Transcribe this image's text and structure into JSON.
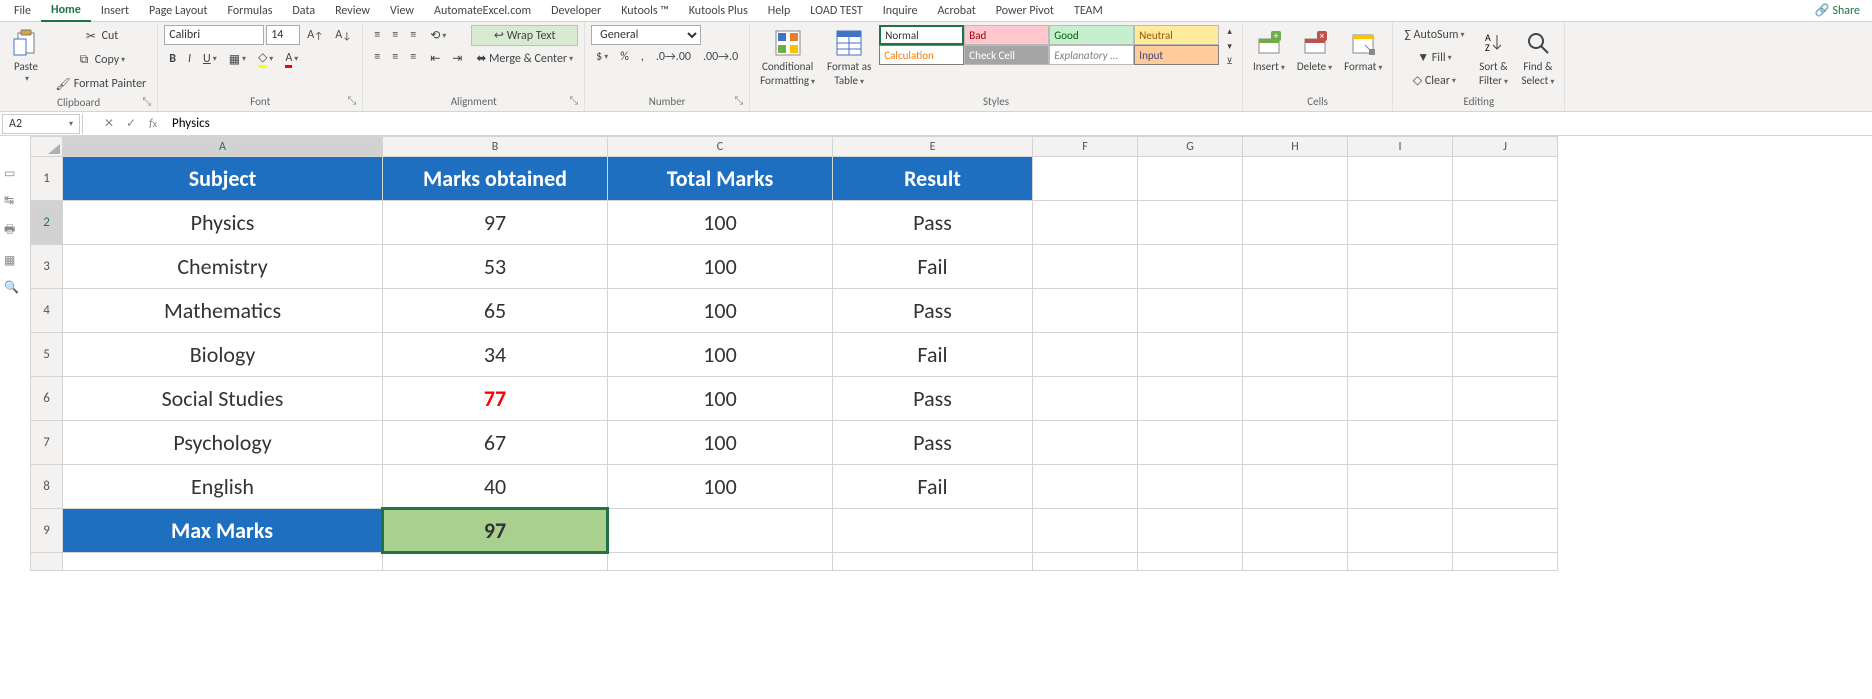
{
  "tabs": {
    "file": "File",
    "home": "Home",
    "insert": "Insert",
    "pagelayout": "Page Layout",
    "formulas": "Formulas",
    "data": "Data",
    "review": "Review",
    "view": "View",
    "automate": "AutomateExcel.com",
    "developer": "Developer",
    "kutools": "Kutools ™",
    "kutoolsplus": "Kutools Plus",
    "help": "Help",
    "loadtest": "LOAD TEST",
    "inquire": "Inquire",
    "acrobat": "Acrobat",
    "powerpivot": "Power Pivot",
    "team": "TEAM",
    "share": "Share"
  },
  "clipboard": {
    "paste": "Paste",
    "cut": "Cut",
    "copy": "Copy",
    "fmt": "Format Painter",
    "label": "Clipboard"
  },
  "font": {
    "name": "Calibri",
    "size": "14",
    "label": "Font"
  },
  "alignment": {
    "wrap": "Wrap Text",
    "merge": "Merge & Center",
    "label": "Alignment"
  },
  "number": {
    "format": "General",
    "label": "Number"
  },
  "styles": {
    "cond": "Conditional",
    "cond2": "Formatting",
    "ftable": "Format as",
    "ftable2": "Table",
    "normal": "Normal",
    "bad": "Bad",
    "good": "Good",
    "neutral": "Neutral",
    "calc": "Calculation",
    "check": "Check Cell",
    "expl": "Explanatory ...",
    "input": "Input",
    "label": "Styles"
  },
  "cells": {
    "insert": "Insert",
    "delete": "Delete",
    "format": "Format",
    "label": "Cells"
  },
  "editing": {
    "autosum": "AutoSum",
    "fill": "Fill",
    "clear": "Clear",
    "sort": "Sort &",
    "sort2": "Filter",
    "find": "Find &",
    "find2": "Select",
    "label": "Editing"
  },
  "namebox": "A2",
  "formula": "Physics",
  "chart_data": {
    "type": "table",
    "columns": [
      "Subject",
      "Marks obtained",
      "Total Marks",
      "Result"
    ],
    "rows": [
      [
        "Physics",
        "97",
        "100",
        "Pass"
      ],
      [
        "Chemistry",
        "53",
        "100",
        "Fail"
      ],
      [
        "Mathematics",
        "65",
        "100",
        "Pass"
      ],
      [
        "Biology",
        "34",
        "100",
        "Fail"
      ],
      [
        "Social Studies",
        "77",
        "100",
        "Pass"
      ],
      [
        "Psychology",
        "67",
        "100",
        "Pass"
      ],
      [
        "English",
        "40",
        "100",
        "Fail"
      ]
    ],
    "footer": {
      "label": "Max Marks",
      "value": "97"
    }
  },
  "colheads": [
    "A",
    "B",
    "C",
    "E",
    "F",
    "G",
    "H",
    "I",
    "J"
  ],
  "rowheads": [
    "1",
    "2",
    "3",
    "4",
    "5",
    "6",
    "7",
    "8",
    "9"
  ]
}
